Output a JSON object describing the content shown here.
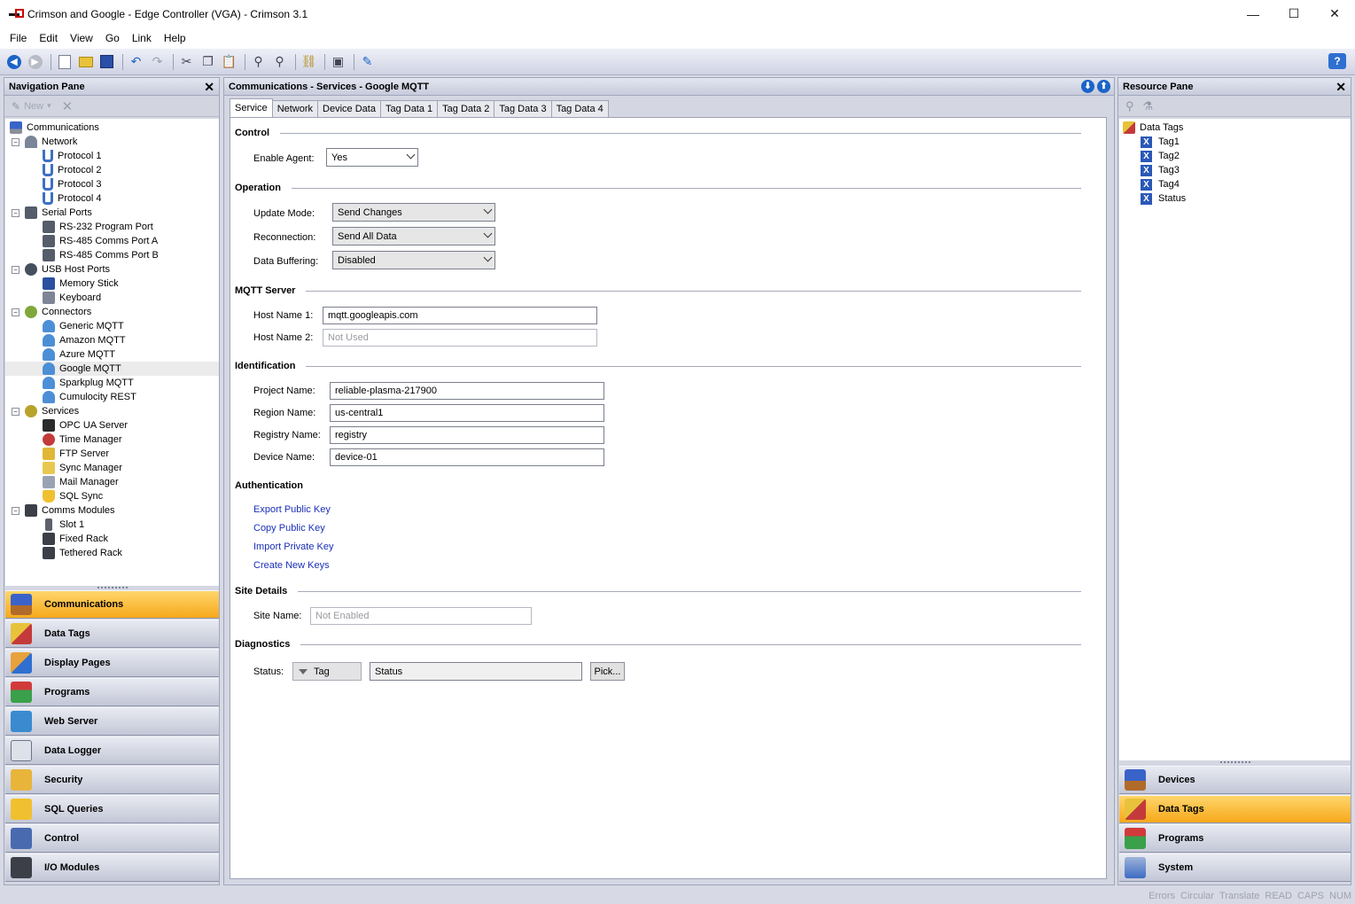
{
  "window": {
    "title": "Crimson and Google - Edge Controller (VGA) - Crimson 3.1",
    "minimize": "—",
    "maximize": "☐",
    "close": "✕"
  },
  "menu": [
    "File",
    "Edit",
    "View",
    "Go",
    "Link",
    "Help"
  ],
  "toolbar": {
    "icons": [
      "back-icon",
      "forward-icon",
      "new-file-icon",
      "open-folder-icon",
      "save-icon",
      "undo-icon",
      "redo-icon",
      "cut-icon",
      "copy-icon",
      "paste-icon",
      "find-icon",
      "find-replace-icon",
      "link-icon",
      "monitor-icon",
      "send-icon"
    ],
    "help": "?"
  },
  "nav_pane": {
    "title": "Navigation Pane",
    "new_label": "New",
    "tree": [
      {
        "label": "Communications",
        "level": 0
      },
      {
        "label": "Network",
        "level": 1
      },
      {
        "label": "Protocol 1",
        "level": 2
      },
      {
        "label": "Protocol 2",
        "level": 2
      },
      {
        "label": "Protocol 3",
        "level": 2
      },
      {
        "label": "Protocol 4",
        "level": 2
      },
      {
        "label": "Serial Ports",
        "level": 1
      },
      {
        "label": "RS-232 Program Port",
        "level": 2
      },
      {
        "label": "RS-485 Comms Port A",
        "level": 2
      },
      {
        "label": "RS-485 Comms Port B",
        "level": 2
      },
      {
        "label": "USB Host Ports",
        "level": 1
      },
      {
        "label": "Memory Stick",
        "level": 2
      },
      {
        "label": "Keyboard",
        "level": 2
      },
      {
        "label": "Connectors",
        "level": 1
      },
      {
        "label": "Generic MQTT",
        "level": 2
      },
      {
        "label": "Amazon MQTT",
        "level": 2
      },
      {
        "label": "Azure MQTT",
        "level": 2
      },
      {
        "label": "Google MQTT",
        "level": 2,
        "selected": true
      },
      {
        "label": "Sparkplug MQTT",
        "level": 2
      },
      {
        "label": "Cumulocity REST",
        "level": 2
      },
      {
        "label": "Services",
        "level": 1
      },
      {
        "label": "OPC UA Server",
        "level": 2
      },
      {
        "label": "Time Manager",
        "level": 2
      },
      {
        "label": "FTP Server",
        "level": 2
      },
      {
        "label": "Sync Manager",
        "level": 2
      },
      {
        "label": "Mail Manager",
        "level": 2
      },
      {
        "label": "SQL Sync",
        "level": 2
      },
      {
        "label": "Comms Modules",
        "level": 1
      },
      {
        "label": "Slot 1",
        "level": 2
      },
      {
        "label": "Fixed Rack",
        "level": 2
      },
      {
        "label": "Tethered Rack",
        "level": 2
      }
    ],
    "buttons": [
      {
        "label": "Communications",
        "active": true
      },
      {
        "label": "Data Tags"
      },
      {
        "label": "Display Pages"
      },
      {
        "label": "Programs"
      },
      {
        "label": "Web Server"
      },
      {
        "label": "Data Logger"
      },
      {
        "label": "Security"
      },
      {
        "label": "SQL Queries"
      },
      {
        "label": "Control"
      },
      {
        "label": "I/O Modules"
      }
    ]
  },
  "center": {
    "title": "Communications - Services - Google MQTT",
    "tabs": [
      "Service",
      "Network",
      "Device Data",
      "Tag Data 1",
      "Tag Data 2",
      "Tag Data 3",
      "Tag Data 4"
    ],
    "active_tab": "Service",
    "sections": {
      "control": "Control",
      "operation": "Operation",
      "mqtt_server": "MQTT Server",
      "identification": "Identification",
      "authentication": "Authentication",
      "site_details": "Site Details",
      "diagnostics": "Diagnostics"
    },
    "fields": {
      "enable_agent": {
        "label": "Enable Agent:",
        "value": "Yes"
      },
      "update_mode": {
        "label": "Update Mode:",
        "value": "Send Changes"
      },
      "reconnection": {
        "label": "Reconnection:",
        "value": "Send All Data"
      },
      "data_buffering": {
        "label": "Data Buffering:",
        "value": "Disabled"
      },
      "host_name_1": {
        "label": "Host Name 1:",
        "value": "mqtt.googleapis.com"
      },
      "host_name_2": {
        "label": "Host Name 2:",
        "value": "Not Used"
      },
      "project_name": {
        "label": "Project Name:",
        "value": "reliable-plasma-217900"
      },
      "region_name": {
        "label": "Region Name:",
        "value": "us-central1"
      },
      "registry_name": {
        "label": "Registry Name:",
        "value": "registry"
      },
      "device_name": {
        "label": "Device Name:",
        "value": "device-01"
      },
      "site_name": {
        "label": "Site Name:",
        "value": "Not Enabled"
      },
      "status": {
        "label": "Status:",
        "mode": "Tag",
        "value": "Status",
        "pick": "Pick..."
      }
    },
    "links": [
      "Export Public Key",
      "Copy Public Key",
      "Import Private Key",
      "Create New Keys"
    ]
  },
  "resource_pane": {
    "title": "Resource Pane",
    "root": "Data Tags",
    "tags": [
      "Tag1",
      "Tag2",
      "Tag3",
      "Tag4",
      "Status"
    ],
    "buttons": [
      {
        "label": "Devices"
      },
      {
        "label": "Data Tags",
        "active": true
      },
      {
        "label": "Programs"
      },
      {
        "label": "System"
      }
    ]
  },
  "statusbar": [
    "Errors",
    "Circular",
    "Translate",
    "READ",
    "CAPS",
    "NUM"
  ]
}
